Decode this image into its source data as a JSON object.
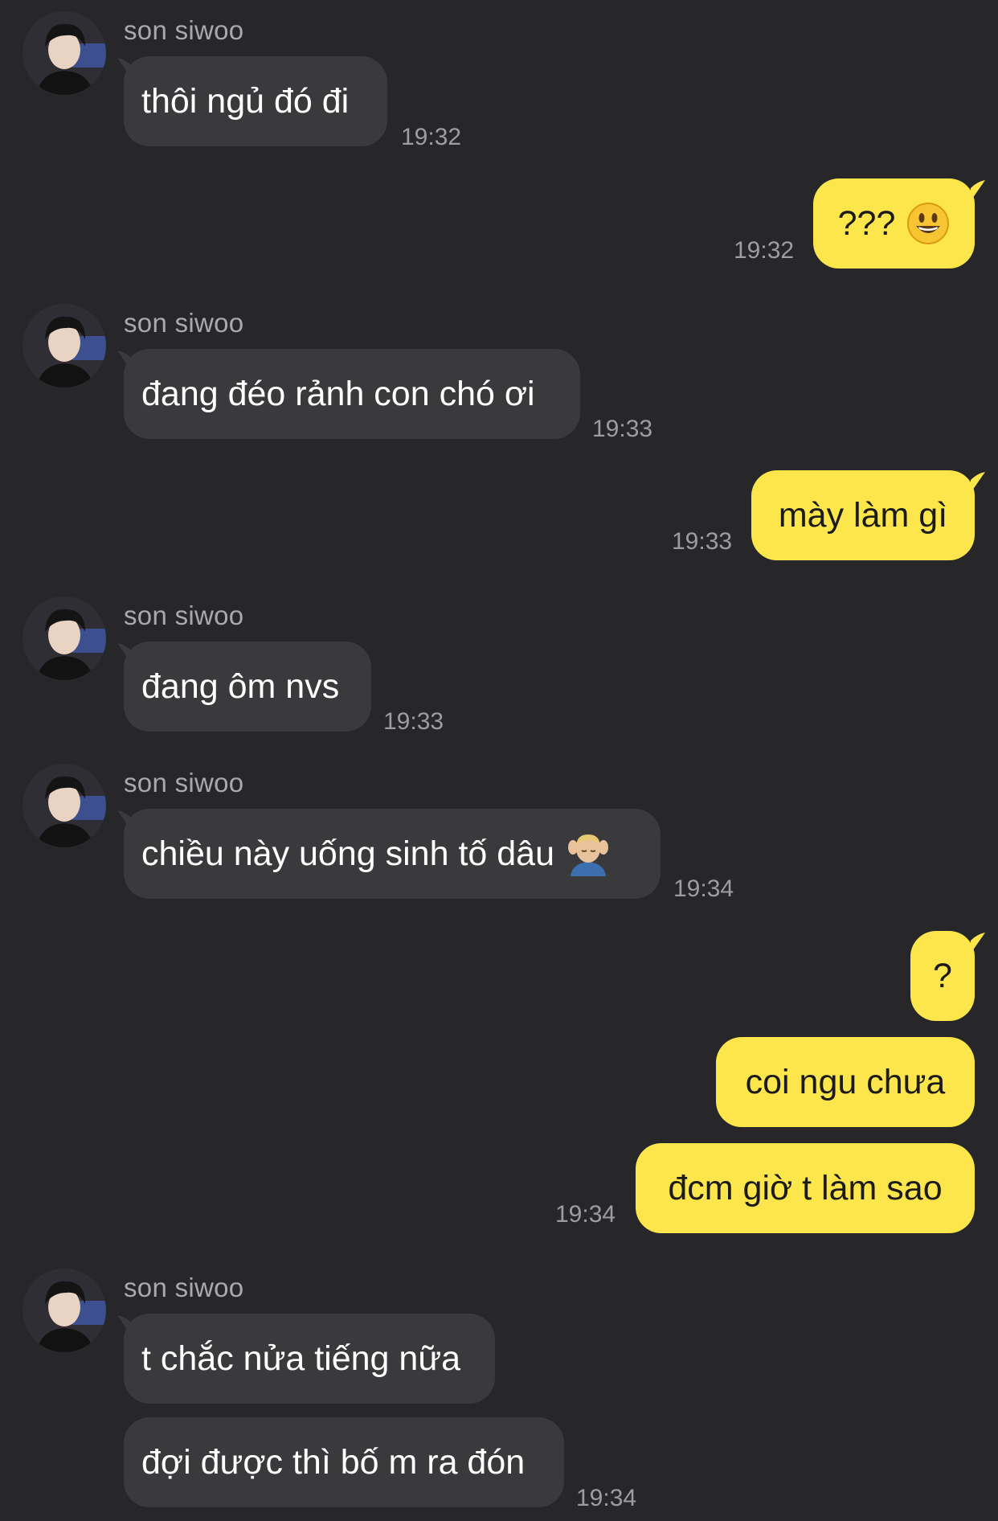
{
  "contact": {
    "name": "son siwoo",
    "avatar_icon": "profile-photo-icon"
  },
  "messages": [
    {
      "from": "other",
      "text": "thôi ngủ đó đi",
      "time": "19:32"
    },
    {
      "from": "me",
      "text": "???",
      "emoji": "grinning-face-emoji",
      "time": "19:32"
    },
    {
      "from": "other",
      "text": "đang đéo rảnh con chó ơi",
      "time": "19:33"
    },
    {
      "from": "me",
      "text": "mày làm gì",
      "time": "19:33"
    },
    {
      "from": "other",
      "text": "đang ôm nvs",
      "time": "19:33"
    },
    {
      "from": "other",
      "text": "chiều này uống sinh tố dâu",
      "emoji": "man-getting-massage-emoji",
      "time": "19:34"
    },
    {
      "from": "me",
      "text": "?"
    },
    {
      "from": "me",
      "text": "coi ngu chưa"
    },
    {
      "from": "me",
      "text": "đcm giờ t làm sao",
      "time": "19:34"
    },
    {
      "from": "other",
      "text": "t chắc nửa tiếng nữa"
    },
    {
      "from": "other",
      "text": "đợi được thì bố m ra đón",
      "time": "19:34"
    }
  ],
  "colors": {
    "background": "#272729",
    "received_bubble": "#3a3a3d",
    "sent_bubble": "#fde64b"
  }
}
